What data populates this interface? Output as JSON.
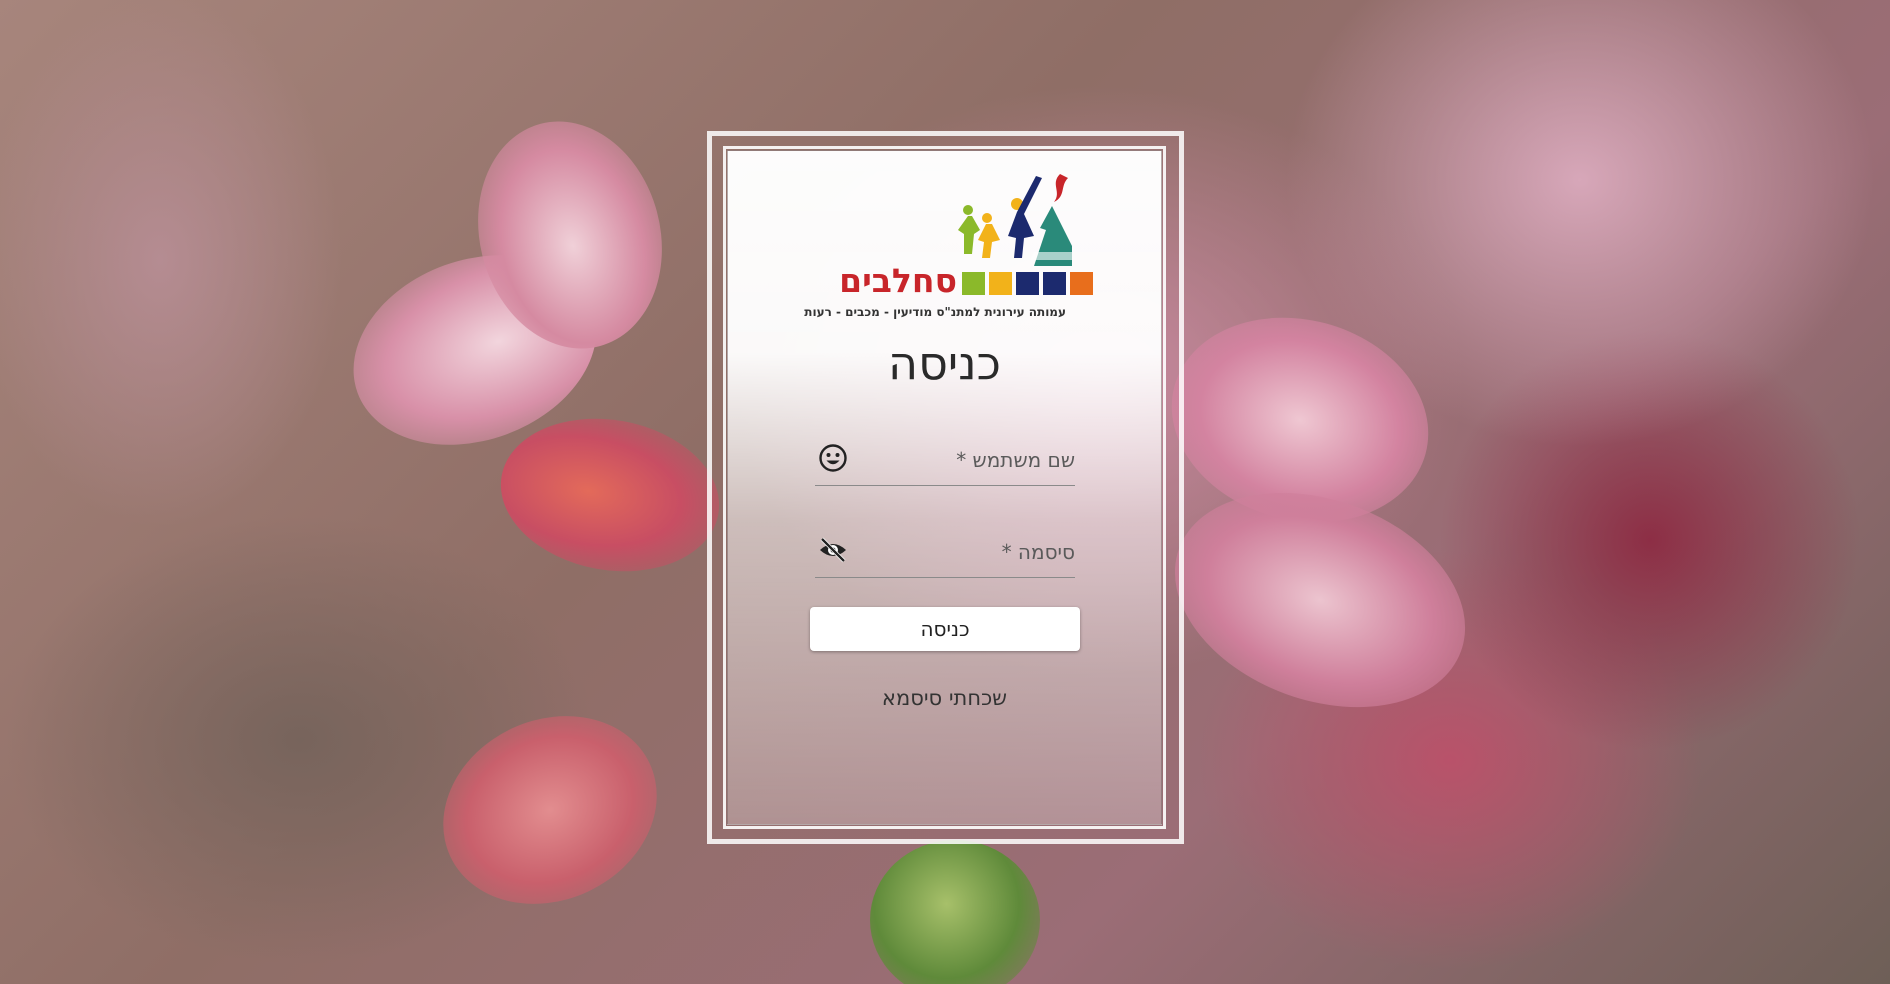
{
  "logo": {
    "name": "סחלבים",
    "tagline": "עמותה עירונית למתנ\"ס מודיעין - מכבים - רעות",
    "square_colors": [
      "#e86e1c",
      "#1c2a6e",
      "#1c2a6e",
      "#8bb92a",
      "#f2b21a"
    ]
  },
  "login": {
    "title": "כניסה",
    "username_label": "שם משתמש *",
    "password_label": "סיסמה *",
    "submit_label": "כניסה",
    "forgot_label": "שכחתי סיסמא"
  },
  "icons": {
    "username": "smiley-icon",
    "password": "eye-off-icon"
  }
}
